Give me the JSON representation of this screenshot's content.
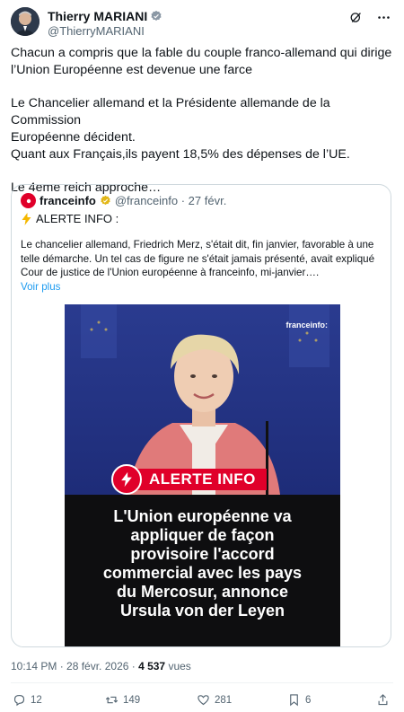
{
  "author": {
    "name": "Thierry MARIANI",
    "handle": "@ThierryMARIANI"
  },
  "tweet": {
    "lines_p1": [
      "Chacun a compris que la fable du couple franco-allemand qui dirige",
      "l’Union Européenne est devenue une farce"
    ],
    "lines_p2": [
      "Le Chancelier allemand et la Présidente allemande de la Commission",
      "Européenne décident.",
      "Quant aux Français,ils payent 18,5% des dépenses de l’UE."
    ],
    "line_p3": "Le 4eme reich approche…"
  },
  "quote": {
    "name": "franceinfo",
    "meta": "@franceinfo · 27 févr.",
    "alert_line": "ALERTE INFO :",
    "body_lines": [
      "Le chancelier allemand, Friedrich Merz, s'était dit, fin janvier, favorable à une",
      "telle démarche. Un tel cas de figure ne s'était jamais présenté, avait expliqué",
      "Cour de justice de l'Union européenne à franceinfo, mi-janvier…."
    ],
    "show_more": "Voir plus",
    "media": {
      "watermark": "franceinfo:",
      "banner": "ALERTE INFO",
      "headline_lines": [
        "L'Union européenne va",
        "appliquer de façon",
        "provisoire l'accord",
        "commercial avec les pays",
        "du Mercosur, annonce",
        "Ursula von der Leyen"
      ]
    }
  },
  "timestamp": {
    "time": "10:14 PM · 28 févr. 2026 · ",
    "views_count": "4 537",
    "views_label": " vues"
  },
  "actions": {
    "replies": "12",
    "reposts": "149",
    "likes": "281",
    "bookmarks": "6"
  },
  "colors": {
    "accent": "#1d9bf0",
    "alert_red": "#e0002a",
    "muted": "#536471"
  }
}
